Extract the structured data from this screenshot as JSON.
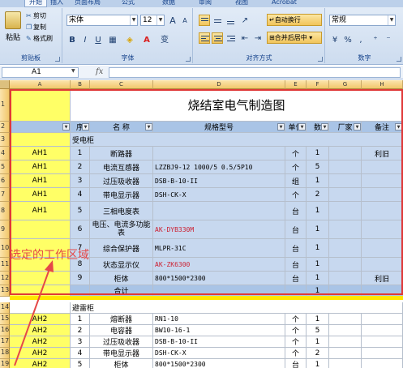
{
  "ribbon": {
    "tabs": [
      "开始",
      "插入",
      "页面布局",
      "公式",
      "数据",
      "审阅",
      "视图",
      "Acrobat"
    ],
    "clipboard": {
      "label": "剪贴板",
      "paste": "粘贴",
      "cut": "剪切",
      "copy": "复制",
      "format_painter": "格式刷"
    },
    "font": {
      "label": "字体",
      "name": "宋体",
      "size": "12",
      "bold": "B",
      "italic": "I",
      "underline": "U",
      "grow": "A",
      "shrink": "A",
      "color_glyph": "A",
      "phonetic": "变"
    },
    "alignment": {
      "label": "对齐方式",
      "wrap": "自动换行",
      "merge": "合并后居中"
    },
    "number": {
      "label": "数字",
      "format": "常规",
      "percent": "%",
      "comma": ","
    }
  },
  "formula_bar": {
    "name_box": "A1",
    "fx": "fx",
    "formula": ""
  },
  "sheet": {
    "columns": [
      "A",
      "B",
      "C",
      "D",
      "E",
      "F",
      "G",
      "H"
    ],
    "rows": [
      "1",
      "2",
      "3",
      "4",
      "5",
      "6",
      "7",
      "8",
      "9",
      "10",
      "11",
      "12",
      "13",
      "14",
      "15",
      "16",
      "17",
      "18",
      "19"
    ],
    "title": "烧结室电气制造图",
    "headers": [
      "序",
      "名 称",
      "规格型号",
      "单位",
      "数",
      "厂家",
      "备注"
    ],
    "section1": "受电柜",
    "table1": [
      {
        "a": "AH1",
        "b": "1",
        "c": "断路器",
        "d": "",
        "e": "个",
        "f": "1",
        "g": "",
        "h": "利旧"
      },
      {
        "a": "AH1",
        "b": "2",
        "c": "电流互感器",
        "d": "LZZBJ9-12  1000/5  0.5/5P10",
        "e": "个",
        "f": "5",
        "g": "",
        "h": ""
      },
      {
        "a": "AH1",
        "b": "3",
        "c": "过压吸收器",
        "d": "DSB-B-10-II",
        "e": "组",
        "f": "1",
        "g": "",
        "h": ""
      },
      {
        "a": "AH1",
        "b": "4",
        "c": "带电显示器",
        "d": "DSH-CK-X",
        "e": "个",
        "f": "2",
        "g": "",
        "h": ""
      },
      {
        "a": "AH1",
        "b": "5",
        "c": "三相电度表",
        "d": "",
        "e": "台",
        "f": "1",
        "g": "",
        "h": ""
      },
      {
        "a": "",
        "b": "6",
        "c": "电压、电流多功能表",
        "d": "AK-DYB330M",
        "e": "台",
        "f": "1",
        "g": "",
        "h": ""
      },
      {
        "a": "",
        "b": "7",
        "c": "综合保护器",
        "d": "MLPR-31C",
        "e": "台",
        "f": "1",
        "g": "",
        "h": ""
      },
      {
        "a": "",
        "b": "8",
        "c": "状态显示仪",
        "d": "AK-ZK6300",
        "e": "台",
        "f": "1",
        "g": "",
        "h": ""
      },
      {
        "a": "",
        "b": "9",
        "c": "柜体",
        "d": "800*1500*2300",
        "e": "台",
        "f": "1",
        "g": "",
        "h": "利旧"
      }
    ],
    "total_label": "合计",
    "total_value": "1",
    "section2": "避雷柜",
    "table2": [
      {
        "a": "AH2",
        "b": "1",
        "c": "熔断器",
        "d": "RN1-10",
        "e": "个",
        "f": "1"
      },
      {
        "a": "AH2",
        "b": "2",
        "c": "电容器",
        "d": "BW10-16-1",
        "e": "个",
        "f": "5"
      },
      {
        "a": "AH2",
        "b": "3",
        "c": "过压吸收器",
        "d": "DSB-B-10-II",
        "e": "个",
        "f": "1"
      },
      {
        "a": "AH2",
        "b": "4",
        "c": "带电显示器",
        "d": "DSH-CK-X",
        "e": "个",
        "f": "2"
      },
      {
        "a": "AH2",
        "b": "5",
        "c": "柜体",
        "d": "800*1500*2300",
        "e": "台",
        "f": "1"
      }
    ]
  },
  "annotation": "选定的工作区域",
  "colors": {
    "selection_border": "#e03838",
    "annotation_text": "#e54848",
    "highlight_yellow": "#ffff66",
    "table_blue": "#c7d8ef",
    "header_orange": "#f2c76b"
  }
}
